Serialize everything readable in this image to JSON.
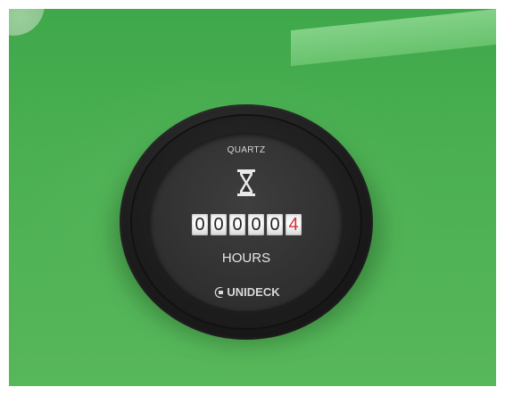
{
  "meter": {
    "top_label": "QUARTZ",
    "icon": "hourglass-icon",
    "digits": [
      "0",
      "0",
      "0",
      "0",
      "0",
      "4"
    ],
    "unit_label": "HOURS",
    "brand": "UNIDECK"
  },
  "colors": {
    "background": "#4bb052",
    "bezel": "#1d1d1d",
    "face": "#2f2f2f",
    "last_digit": "#d0343a"
  }
}
